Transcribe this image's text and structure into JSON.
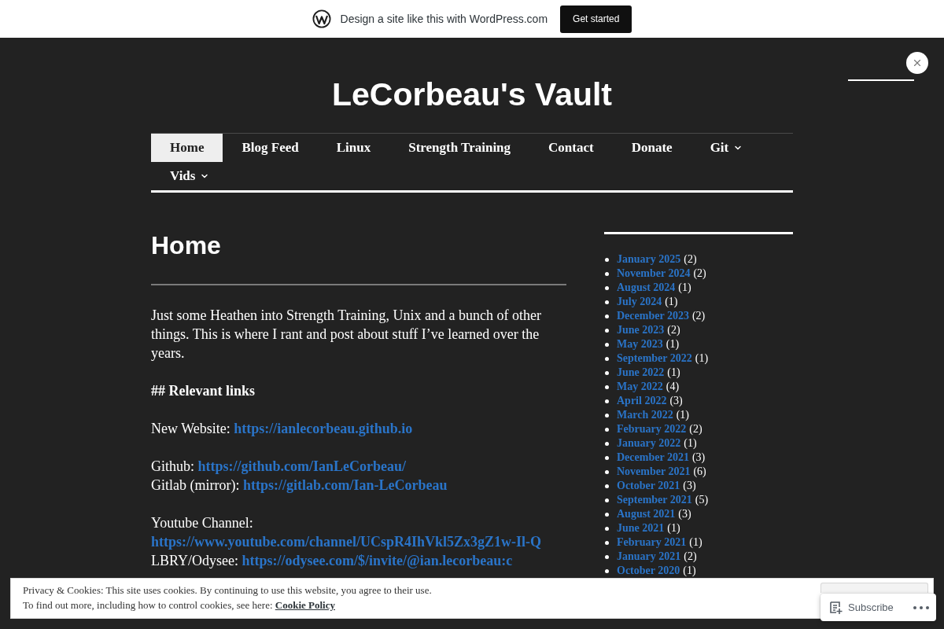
{
  "promo_bar": {
    "text": "Design a site like this with WordPress.com",
    "button": "Get started"
  },
  "site_title": "LeCorbeau's Vault",
  "nav": [
    {
      "label": "Home",
      "selected": true,
      "submenu": false
    },
    {
      "label": "Blog Feed",
      "selected": false,
      "submenu": false
    },
    {
      "label": "Linux",
      "selected": false,
      "submenu": false
    },
    {
      "label": "Strength Training",
      "selected": false,
      "submenu": false
    },
    {
      "label": "Contact",
      "selected": false,
      "submenu": false
    },
    {
      "label": "Donate",
      "selected": false,
      "submenu": false
    },
    {
      "label": "Git",
      "selected": false,
      "submenu": true
    },
    {
      "label": "Vids",
      "selected": false,
      "submenu": true
    }
  ],
  "page": {
    "title": "Home",
    "intro": "Just some Heathen into Strength Training, Unix and a bunch of other things. This is where I rant and post about stuff I’ve learned over the years.",
    "heading": "## Relevant links",
    "link_blocks": [
      [
        {
          "label": "New Website:",
          "url": "https://ianlecorbeau.github.io"
        }
      ],
      [
        {
          "label": "Github:",
          "url": "https://github.com/IanLeCorbeau/"
        },
        {
          "label": "Gitlab (mirror):",
          "url": "https://gitlab.com/Ian-LeCorbeau"
        }
      ],
      [
        {
          "label": "Youtube Channel:",
          "url": "https://www.youtube.com/channel/UCspR4IhVkl5Zx3gZ1w-Il-Q"
        },
        {
          "label": "LBRY/Odysee:",
          "url": "https://odysee.com/$/invite/@ian.lecorbeau:c"
        }
      ]
    ]
  },
  "archives": [
    {
      "month": "January 2025",
      "count": "(2)"
    },
    {
      "month": "November 2024",
      "count": "(2)"
    },
    {
      "month": "August 2024",
      "count": "(1)"
    },
    {
      "month": "July 2024",
      "count": "(1)"
    },
    {
      "month": "December 2023",
      "count": "(2)"
    },
    {
      "month": "June 2023",
      "count": "(2)"
    },
    {
      "month": "May 2023",
      "count": "(1)"
    },
    {
      "month": "September 2022",
      "count": "(1)"
    },
    {
      "month": "June 2022",
      "count": "(1)"
    },
    {
      "month": "May 2022",
      "count": "(4)"
    },
    {
      "month": "April 2022",
      "count": "(3)"
    },
    {
      "month": "March 2022",
      "count": "(1)"
    },
    {
      "month": "February 2022",
      "count": "(2)"
    },
    {
      "month": "January 2022",
      "count": "(1)"
    },
    {
      "month": "December 2021",
      "count": "(3)"
    },
    {
      "month": "November 2021",
      "count": "(6)"
    },
    {
      "month": "October 2021",
      "count": "(3)"
    },
    {
      "month": "September 2021",
      "count": "(5)"
    },
    {
      "month": "August 2021",
      "count": "(3)"
    },
    {
      "month": "June 2021",
      "count": "(1)"
    },
    {
      "month": "February 2021",
      "count": "(1)"
    },
    {
      "month": "January 2021",
      "count": "(2)"
    },
    {
      "month": "October 2020",
      "count": "(1)"
    }
  ],
  "cookie_banner": {
    "lines": [
      "Privacy & Cookies: This site uses cookies. By continuing to use this website, you agree to their use.",
      "To find out more, including how to control cookies, see here:"
    ],
    "link": "Cookie Policy"
  },
  "subscribe": {
    "label": "Subscribe"
  }
}
